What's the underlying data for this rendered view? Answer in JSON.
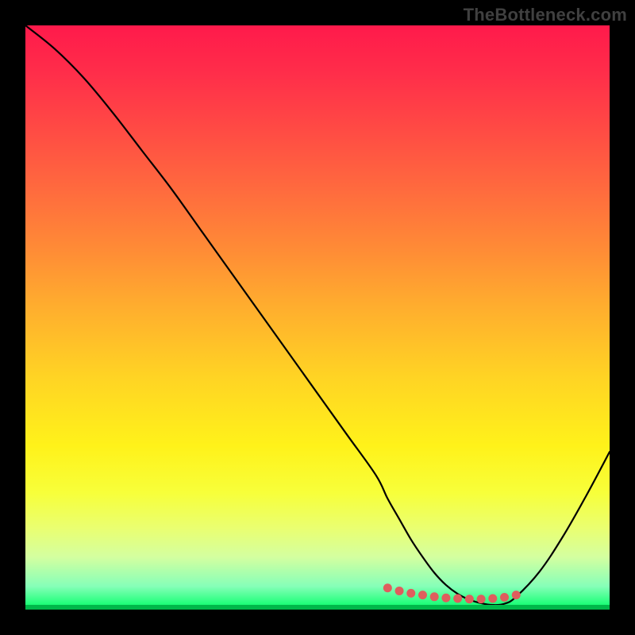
{
  "watermark": "TheBottleneck.com",
  "chart_data": {
    "type": "line",
    "title": "",
    "xlabel": "",
    "ylabel": "",
    "xlim": [
      0,
      100
    ],
    "ylim": [
      0,
      100
    ],
    "grid": false,
    "series": [
      {
        "name": "curve",
        "x": [
          0,
          5,
          10,
          15,
          20,
          25,
          30,
          35,
          40,
          45,
          50,
          55,
          60,
          62,
          64,
          66,
          68,
          70,
          72,
          74,
          76,
          78,
          80,
          82,
          84,
          88,
          92,
          96,
          100
        ],
        "values": [
          100,
          96,
          91,
          85,
          78.5,
          72,
          65,
          58,
          51,
          44,
          37,
          30,
          23,
          19,
          15.5,
          12,
          9,
          6.3,
          4.2,
          2.7,
          1.7,
          1.1,
          0.8,
          1.0,
          2.2,
          6.5,
          12.5,
          19.5,
          27
        ]
      },
      {
        "name": "highlight-dots",
        "x": [
          62,
          64,
          66,
          68,
          70,
          72,
          74,
          76,
          78,
          80,
          82,
          84
        ],
        "values": [
          3.7,
          3.2,
          2.8,
          2.5,
          2.2,
          2.0,
          1.9,
          1.8,
          1.8,
          1.9,
          2.1,
          2.5
        ]
      }
    ],
    "colors": {
      "curve_stroke": "#000000",
      "dots_stroke": "#df5d5d",
      "gradient_top": "#ff1a4b",
      "gradient_bottom": "#00ff66",
      "frame": "#000000"
    }
  }
}
